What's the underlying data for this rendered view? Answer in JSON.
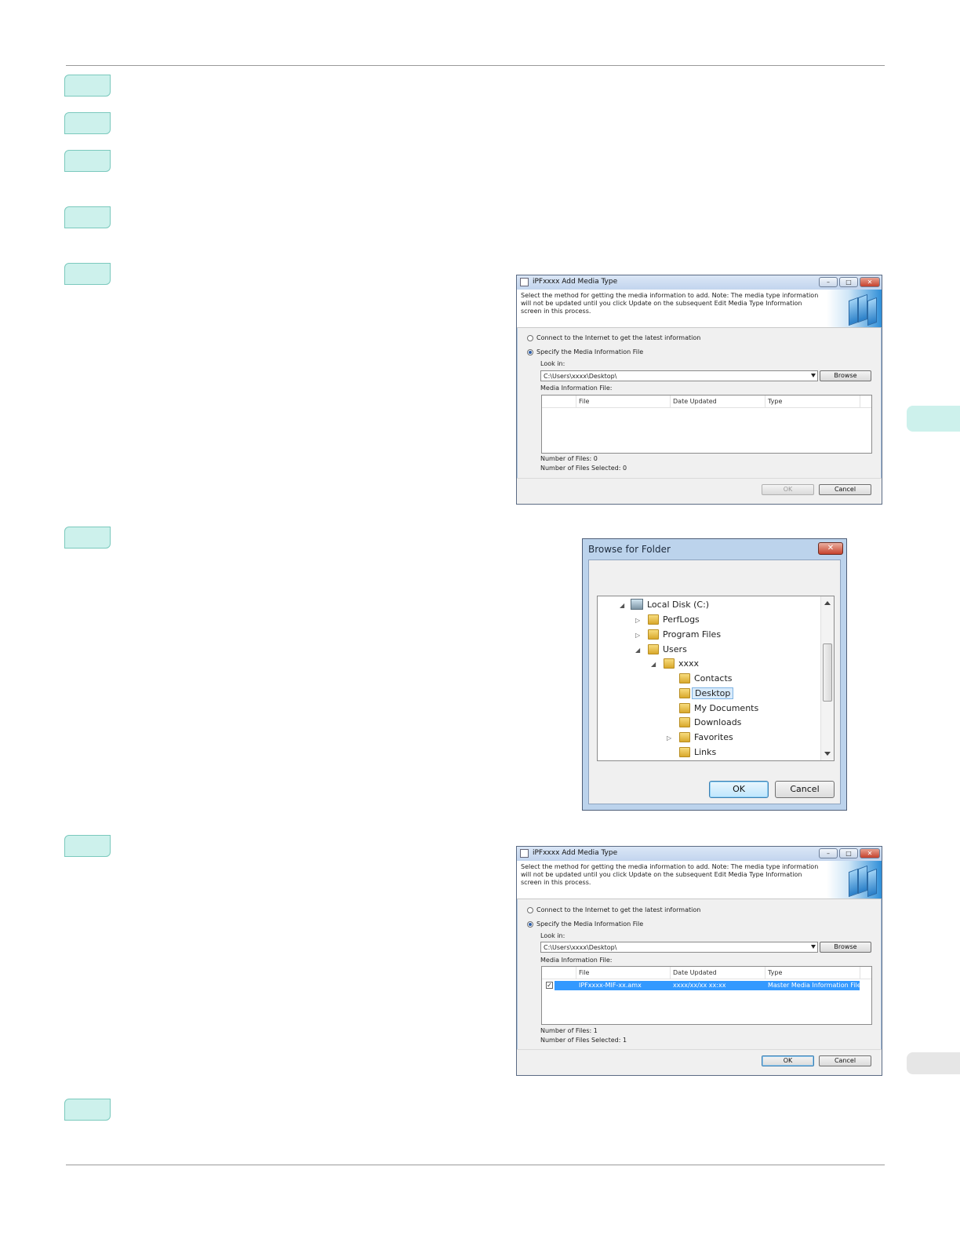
{
  "dialog1": {
    "title": "iPFxxxx Add Media Type",
    "header_text": "Select the method for getting the media information to add.\nNote: The media type information will not be updated until you click Update on the subsequent Edit Media Type Information screen in this process.",
    "radio_internet": "Connect to the Internet to get the latest information",
    "radio_file": "Specify the Media Information File",
    "look_in_label": "Look in:",
    "look_in_value": "C:\\Users\\xxxx\\Desktop\\",
    "browse": "Browse",
    "file_list_label": "Media Information File:",
    "columns": [
      "File",
      "Date Updated",
      "Type"
    ],
    "num_files": "Number of Files: 0",
    "num_selected": "Number of Files Selected: 0",
    "ok": "OK",
    "cancel": "Cancel"
  },
  "browse_folder": {
    "title": "Browse for Folder",
    "tree": [
      {
        "label": "Local Disk (C:)",
        "icon": "drive-icon",
        "expander": "◢",
        "level": 0
      },
      {
        "label": "PerfLogs",
        "icon": "folder-icon",
        "expander": "▷",
        "level": 1
      },
      {
        "label": "Program Files",
        "icon": "folder-icon",
        "expander": "▷",
        "level": 1
      },
      {
        "label": "Users",
        "icon": "folder-icon",
        "expander": "◢",
        "level": 1
      },
      {
        "label": "xxxx",
        "icon": "folder-icon",
        "expander": "◢",
        "level": 2
      },
      {
        "label": "Contacts",
        "icon": "contacts-folder-icon",
        "expander": "",
        "level": 3
      },
      {
        "label": "Desktop",
        "icon": "desktop-folder-icon",
        "expander": "",
        "level": 3,
        "selected": true
      },
      {
        "label": "My Documents",
        "icon": "documents-folder-icon",
        "expander": "",
        "level": 3
      },
      {
        "label": "Downloads",
        "icon": "downloads-folder-icon",
        "expander": "",
        "level": 3
      },
      {
        "label": "Favorites",
        "icon": "favorites-folder-icon",
        "expander": "▷",
        "level": 3
      },
      {
        "label": "Links",
        "icon": "links-folder-icon",
        "expander": "",
        "level": 3
      }
    ],
    "ok": "OK",
    "cancel": "Cancel"
  },
  "dialog2": {
    "title": "iPFxxxx Add Media Type",
    "header_text": "Select the method for getting the media information to add.\nNote: The media type information will not be updated until you click Update on the subsequent Edit Media Type Information screen in this process.",
    "radio_internet": "Connect to the Internet to get the latest information",
    "radio_file": "Specify the Media Information File",
    "look_in_label": "Look in:",
    "look_in_value": "C:\\Users\\xxxx\\Desktop\\",
    "browse": "Browse",
    "file_list_label": "Media Information File:",
    "columns": [
      "File",
      "Date Updated",
      "Type"
    ],
    "row": {
      "file": "IPFxxxx-MIF-xx.amx",
      "date": "xxxx/xx/xx xx:xx",
      "type": "Master Media Information File",
      "checked": "✓"
    },
    "num_files": "Number of Files: 1",
    "num_selected": "Number of Files Selected: 1",
    "ok": "OK",
    "cancel": "Cancel"
  },
  "colors": {
    "step_fill": "#cdf1ec",
    "side_tab_green": "#cdf1ec",
    "side_tab_gray": "#e6e6e6",
    "selection": "#3399ff"
  }
}
